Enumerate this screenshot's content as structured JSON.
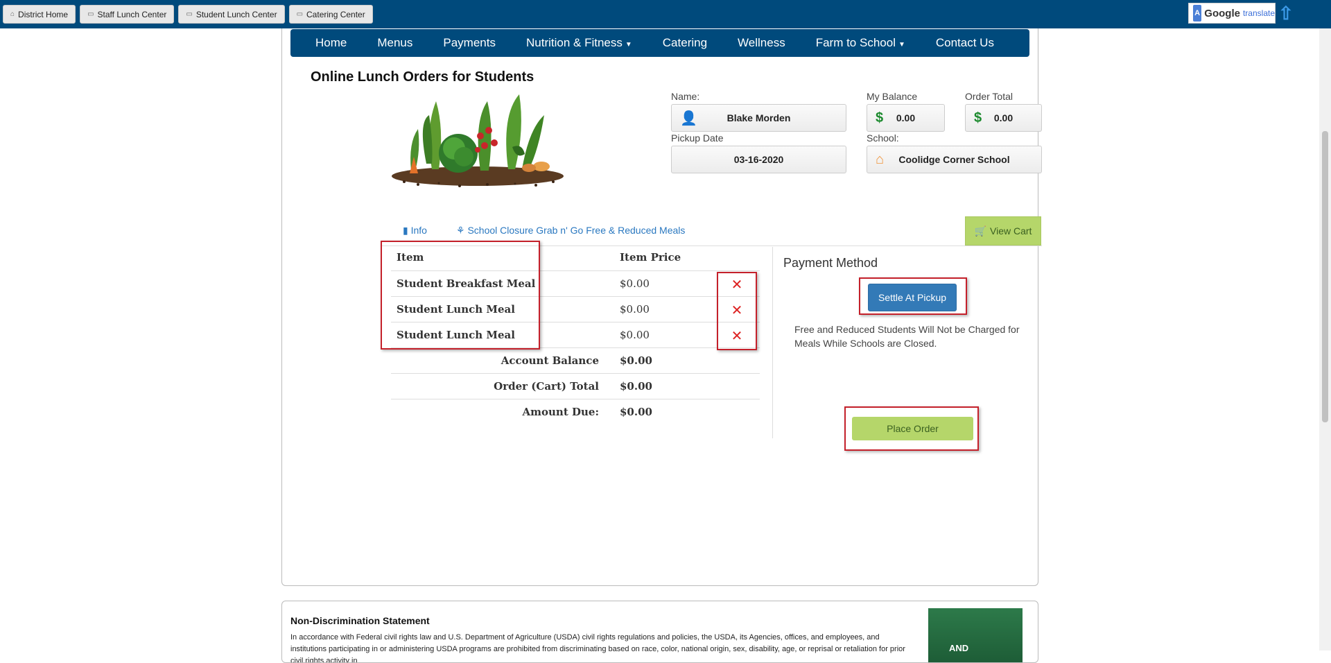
{
  "topbar": {
    "tabs": [
      {
        "label": "District Home",
        "icon": "home-icon"
      },
      {
        "label": "Staff Lunch Center",
        "icon": "cart-icon"
      },
      {
        "label": "Student Lunch Center",
        "icon": "cart-icon"
      },
      {
        "label": "Catering Center",
        "icon": "cart-icon"
      }
    ],
    "translate": {
      "badge": "A",
      "logo": "Google",
      "word": "translate"
    }
  },
  "nav": {
    "items": [
      {
        "label": "Home"
      },
      {
        "label": "Menus"
      },
      {
        "label": "Payments"
      },
      {
        "label": "Nutrition & Fitness",
        "dropdown": true
      },
      {
        "label": "Catering"
      },
      {
        "label": "Wellness"
      },
      {
        "label": "Farm to School",
        "dropdown": true
      },
      {
        "label": "Contact Us"
      }
    ]
  },
  "page": {
    "title": "Online Lunch Orders for Students"
  },
  "fields": {
    "name_label": "Name:",
    "name_value": "Blake Morden",
    "balance_label": "My Balance",
    "balance_value": "0.00",
    "order_total_label": "Order Total",
    "order_total_value": "0.00",
    "currency": "$",
    "pickup_label": "Pickup Date",
    "pickup_value": "03-16-2020",
    "school_label": "School:",
    "school_value": "Coolidge Corner School"
  },
  "links": {
    "info": "Info",
    "closure": "School Closure Grab n' Go Free & Reduced Meals",
    "view_cart": "View Cart"
  },
  "cart": {
    "header_item": "Item",
    "header_price": "Item Price",
    "items": [
      {
        "name": "Student Breakfast Meal",
        "price": "$0.00"
      },
      {
        "name": "Student Lunch Meal",
        "price": "$0.00"
      },
      {
        "name": "Student Lunch Meal",
        "price": "$0.00"
      }
    ],
    "summary": [
      {
        "label": "Account Balance",
        "value": "$0.00"
      },
      {
        "label": "Order (Cart) Total",
        "value": "$0.00"
      },
      {
        "label": "Amount Due:",
        "value": "$0.00"
      }
    ]
  },
  "payment": {
    "title": "Payment Method",
    "settle_label": "Settle At Pickup",
    "note": "Free and Reduced Students Will Not be Charged for Meals While Schools are Closed.",
    "place_order_label": "Place Order"
  },
  "nondiscrimination": {
    "title": "Non-Discrimination Statement",
    "text": "In accordance with Federal civil rights law and U.S. Department of Agriculture (USDA) civil rights regulations and policies, the USDA, its Agencies, offices, and employees, and institutions participating in or administering USDA programs are prohibited from discriminating based on race, color, national origin, sex, disability, age, or reprisal or retaliation for prior civil rights activity in",
    "poster_text": "AND"
  },
  "colors": {
    "navy": "#004a7c",
    "accent_green": "#b5d66a",
    "button_blue": "#337ab7",
    "highlight_red": "#c4202a"
  }
}
